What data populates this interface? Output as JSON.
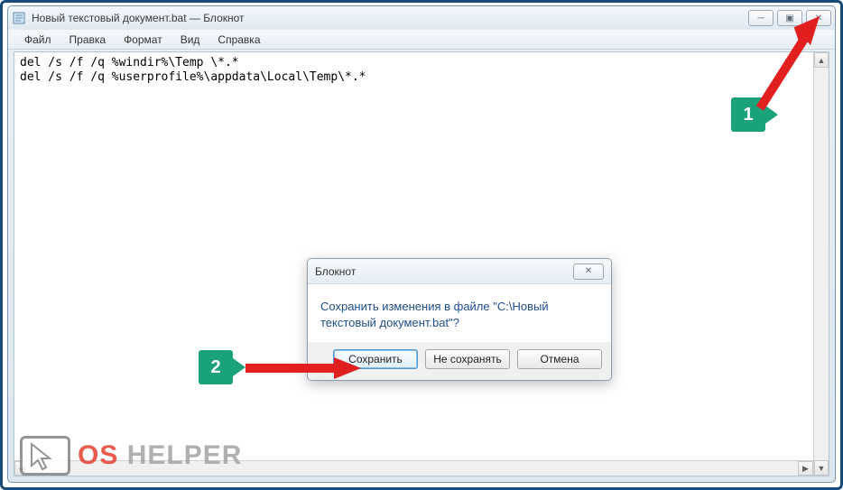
{
  "window": {
    "title": "Новый текстовый документ.bat — Блокнот",
    "controls": {
      "minimize": "─",
      "maximize": "▣",
      "close": "✕"
    }
  },
  "menu": {
    "file": "Файл",
    "edit": "Правка",
    "format": "Формат",
    "view": "Вид",
    "help": "Справка"
  },
  "editor": {
    "line1": "del /s /f /q %windir%\\Temp \\*.*",
    "line2": "del /s /f /q %userprofile%\\appdata\\Local\\Temp\\*.*"
  },
  "dialog": {
    "title": "Блокнот",
    "message": "Сохранить изменения в файле \"C:\\Новый текстовый документ.bat\"?",
    "save": "Сохранить",
    "dont_save": "Не сохранять",
    "cancel": "Отмена",
    "close": "✕"
  },
  "callouts": {
    "one": "1",
    "two": "2"
  },
  "watermark": {
    "os": "OS",
    "rest": " HELPER"
  }
}
